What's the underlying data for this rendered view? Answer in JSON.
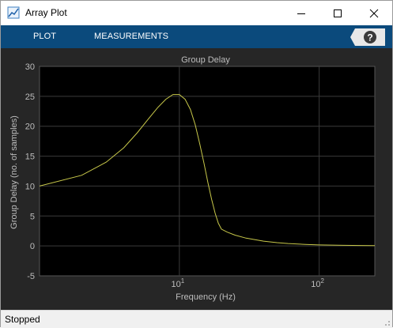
{
  "window": {
    "title": "Array Plot"
  },
  "toolstrip": {
    "tabs": [
      "PLOT",
      "MEASUREMENTS"
    ],
    "help_label": "?"
  },
  "colors": {
    "toolstrip_bg": "#0b4a7c",
    "plot_bg": "#000000",
    "figure_bg": "#262626",
    "trace": "#c8c84a",
    "grid": "#3a3a3a"
  },
  "chart_data": {
    "type": "line",
    "title": "Group Delay",
    "xlabel": "Frequency (Hz)",
    "ylabel": "Group Delay (no. of samples)",
    "x_scale": "log",
    "xlim": [
      1,
      250
    ],
    "ylim": [
      -5,
      30
    ],
    "yticks": [
      "30",
      "25",
      "20",
      "15",
      "10",
      "5",
      "0",
      "-5"
    ],
    "xticks": [
      {
        "base": "10",
        "exp": "1",
        "value": 10
      },
      {
        "base": "10",
        "exp": "2",
        "value": 100
      }
    ],
    "grid": true,
    "series": [
      {
        "x": [
          1,
          2,
          3,
          4,
          5,
          6,
          7,
          8,
          9,
          10,
          11,
          12,
          13,
          14,
          15,
          16,
          17,
          18,
          19,
          20,
          22,
          25,
          30,
          40,
          50,
          60,
          80,
          100,
          150,
          200,
          250
        ],
        "y": [
          10,
          11.8,
          14,
          16.4,
          18.9,
          21.2,
          23.1,
          24.5,
          25.3,
          25.3,
          24.5,
          22.8,
          20.2,
          17,
          13.8,
          10.6,
          7.8,
          5.5,
          3.8,
          2.8,
          2.3,
          1.8,
          1.3,
          0.8,
          0.55,
          0.4,
          0.25,
          0.17,
          0.1,
          0.07,
          0.05
        ]
      }
    ]
  },
  "status": {
    "text": "Stopped"
  }
}
